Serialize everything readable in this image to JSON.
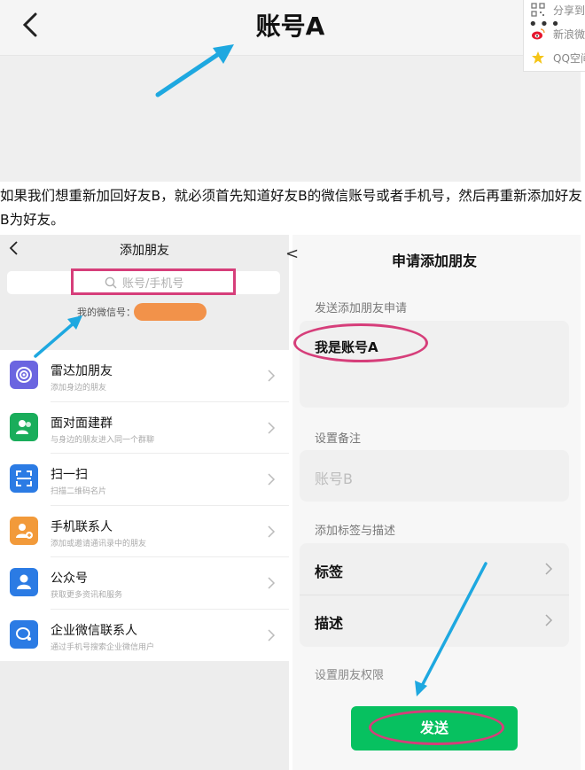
{
  "top_screen": {
    "title": "账号A"
  },
  "share_panel": {
    "items": [
      {
        "icon": "qr-code-icon",
        "label": "分享到"
      },
      {
        "icon": "weibo-icon",
        "label": "新浪微"
      },
      {
        "icon": "qzone-star-icon",
        "label": "QQ空间"
      }
    ],
    "more_dots": "•••"
  },
  "caption": "如果我们想重新加回好友B，就必须首先知道好友B的微信账号或者手机号，然后再重新添加好友B为好友。",
  "add_friends_screen": {
    "title": "添加朋友",
    "search_placeholder": "账号/手机号",
    "my_wechat_label": "我的微信号：",
    "menu": [
      {
        "title": "雷达加朋友",
        "subtitle": "添加身边的朋友",
        "icon": "radar-icon",
        "color": "#6b65e0"
      },
      {
        "title": "面对面建群",
        "subtitle": "与身边的朋友进入同一个群聊",
        "icon": "group-icon",
        "color": "#1aad5b"
      },
      {
        "title": "扫一扫",
        "subtitle": "扫描二维码名片",
        "icon": "scan-icon",
        "color": "#2b7be4"
      },
      {
        "title": "手机联系人",
        "subtitle": "添加或邀请通讯录中的朋友",
        "icon": "contact-add-icon",
        "color": "#f29a3a"
      },
      {
        "title": "公众号",
        "subtitle": "获取更多资讯和服务",
        "icon": "official-account-icon",
        "color": "#2b7be4"
      },
      {
        "title": "企业微信联系人",
        "subtitle": "通过手机号搜索企业微信用户",
        "icon": "work-wechat-icon",
        "color": "#2b7be4"
      }
    ]
  },
  "request_screen": {
    "back_partial": "<",
    "title": "申请添加朋友",
    "send_request_label": "发送添加朋友申请",
    "message": "我是账号A",
    "remark_label": "设置备注",
    "remark_value": "账号B",
    "tags_label": "添加标签与描述",
    "tags_row": "标签",
    "desc_row": "描述",
    "permission_label": "设置朋友权限",
    "send_button": "发送"
  },
  "colors": {
    "highlight": "#d63e7a",
    "arrow": "#1ea8e0",
    "wechat_green": "#07c160",
    "id_pill": "#f2924a"
  }
}
